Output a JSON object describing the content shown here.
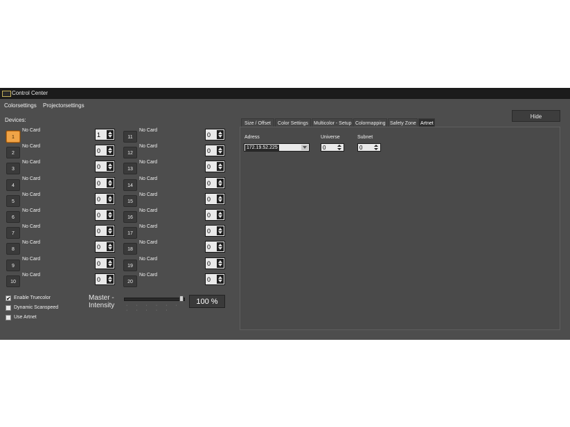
{
  "window": {
    "title": "Control Center"
  },
  "menu": {
    "items": [
      "Colorsettings",
      "Projectorsettings"
    ]
  },
  "devices": {
    "label": "Devices:",
    "left": [
      {
        "num": "1",
        "status": "No Card",
        "value": "1"
      },
      {
        "num": "2",
        "status": "No Card",
        "value": "0"
      },
      {
        "num": "3",
        "status": "No Card",
        "value": "0"
      },
      {
        "num": "4",
        "status": "No Card",
        "value": "0"
      },
      {
        "num": "5",
        "status": "No Card",
        "value": "0"
      },
      {
        "num": "6",
        "status": "No Card",
        "value": "0"
      },
      {
        "num": "7",
        "status": "No Card",
        "value": "0"
      },
      {
        "num": "8",
        "status": "No Card",
        "value": "0"
      },
      {
        "num": "9",
        "status": "No Card",
        "value": "0"
      },
      {
        "num": "10",
        "status": "No Card",
        "value": "0"
      }
    ],
    "right": [
      {
        "num": "11",
        "status": "No Card",
        "value": "0"
      },
      {
        "num": "12",
        "status": "No Card",
        "value": "0"
      },
      {
        "num": "13",
        "status": "No Card",
        "value": "0"
      },
      {
        "num": "14",
        "status": "No Card",
        "value": "0"
      },
      {
        "num": "15",
        "status": "No Card",
        "value": "0"
      },
      {
        "num": "16",
        "status": "No Card",
        "value": "0"
      },
      {
        "num": "17",
        "status": "No Card",
        "value": "0"
      },
      {
        "num": "18",
        "status": "No Card",
        "value": "0"
      },
      {
        "num": "19",
        "status": "No Card",
        "value": "0"
      },
      {
        "num": "20",
        "status": "No Card",
        "value": "0"
      }
    ]
  },
  "options": [
    {
      "label": "Enable Truecolor",
      "checked": true
    },
    {
      "label": "Dynamic Scanspeed",
      "checked": false
    },
    {
      "label": "Use Artnet",
      "checked": false
    }
  ],
  "master": {
    "label_line1": "Master -",
    "label_line2": "Intensity",
    "value_text": "100 %",
    "level": 1.0
  },
  "hide_label": "Hide",
  "tabs": [
    "Size / Offset",
    "Color Settings",
    "Multicolor - Setup",
    "Colormapping",
    "Safety Zone",
    "Artnet"
  ],
  "active_tab": 5,
  "artnet": {
    "address_label": "Adress",
    "address_value": "172.19.52.225",
    "universe_label": "Universe",
    "universe_value": "0",
    "subnet_label": "Subnet",
    "subnet_value": "0"
  },
  "colors": {
    "accent": "#f0a447",
    "background": "#4d4d4d",
    "titlebar": "#1b1b1b"
  }
}
